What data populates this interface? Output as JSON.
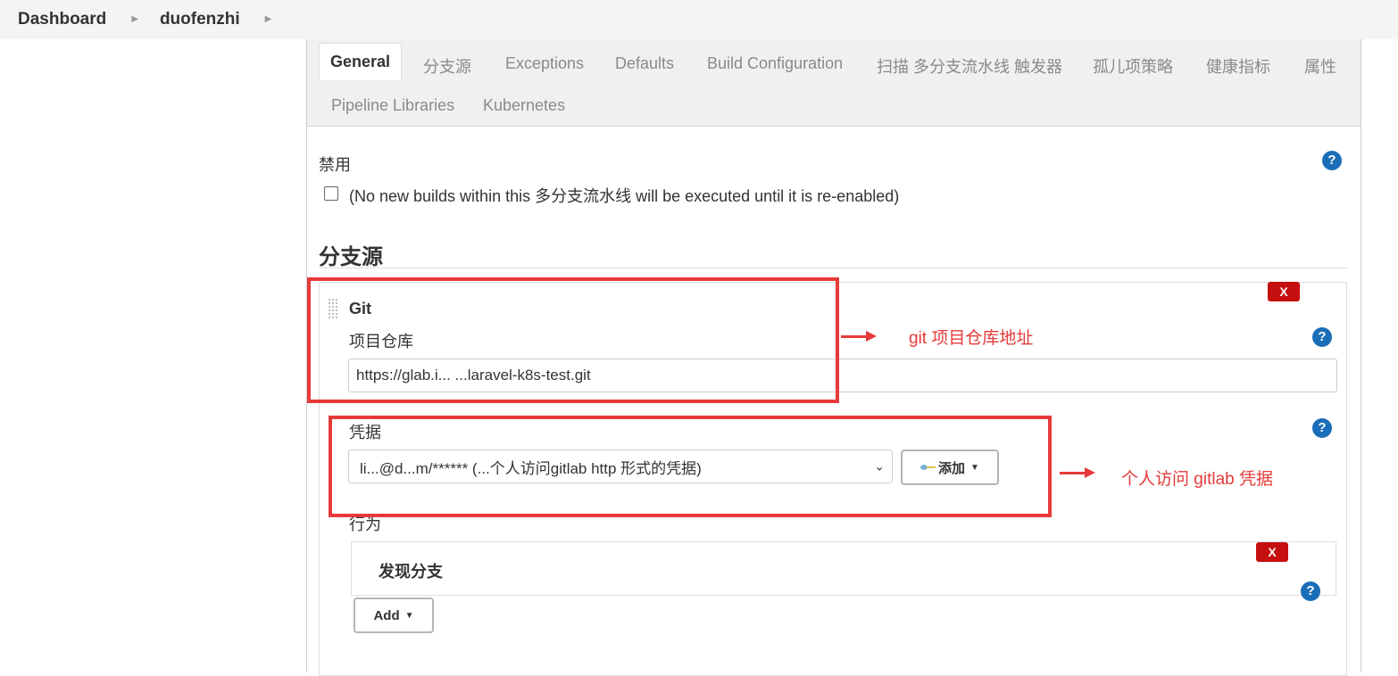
{
  "breadcrumb": {
    "items": [
      "Dashboard",
      "duofenzhi"
    ]
  },
  "tabs": [
    "General",
    "分支源",
    "Exceptions",
    "Defaults",
    "Build Configuration",
    "扫描 多分支流水线 触发器",
    "孤儿项策略",
    "健康指标",
    "属性",
    "Pipeline Libraries",
    "Kubernetes"
  ],
  "active_tab": "General",
  "disable": {
    "title": "禁用",
    "checkbox_label": "(No new builds within this 多分支流水线 will be executed until it is re-enabled)",
    "checked": false
  },
  "branch_sources": {
    "heading": "分支源",
    "git": {
      "title": "Git",
      "repo_label": "项目仓库",
      "repo_value": "https://glab.i...  ...laravel-k8s-test.git",
      "credentials_label": "凭据",
      "credentials_value": "li...@d...m/****** (...个人访问gitlab http 形式的凭据)",
      "add_button": "添加",
      "behavior_label": "行为",
      "behavior_item": "发现分支",
      "add_behavior_button": "Add"
    },
    "delete_label": "X"
  },
  "help_icon_text": "?",
  "annotations": {
    "repo_note": "git 项目仓库地址",
    "credentials_note": "个人访问 gitlab 凭据"
  },
  "colors": {
    "annotation": "#e63a3a",
    "help": "#1a6eb8",
    "delete": "#c50f0f"
  }
}
